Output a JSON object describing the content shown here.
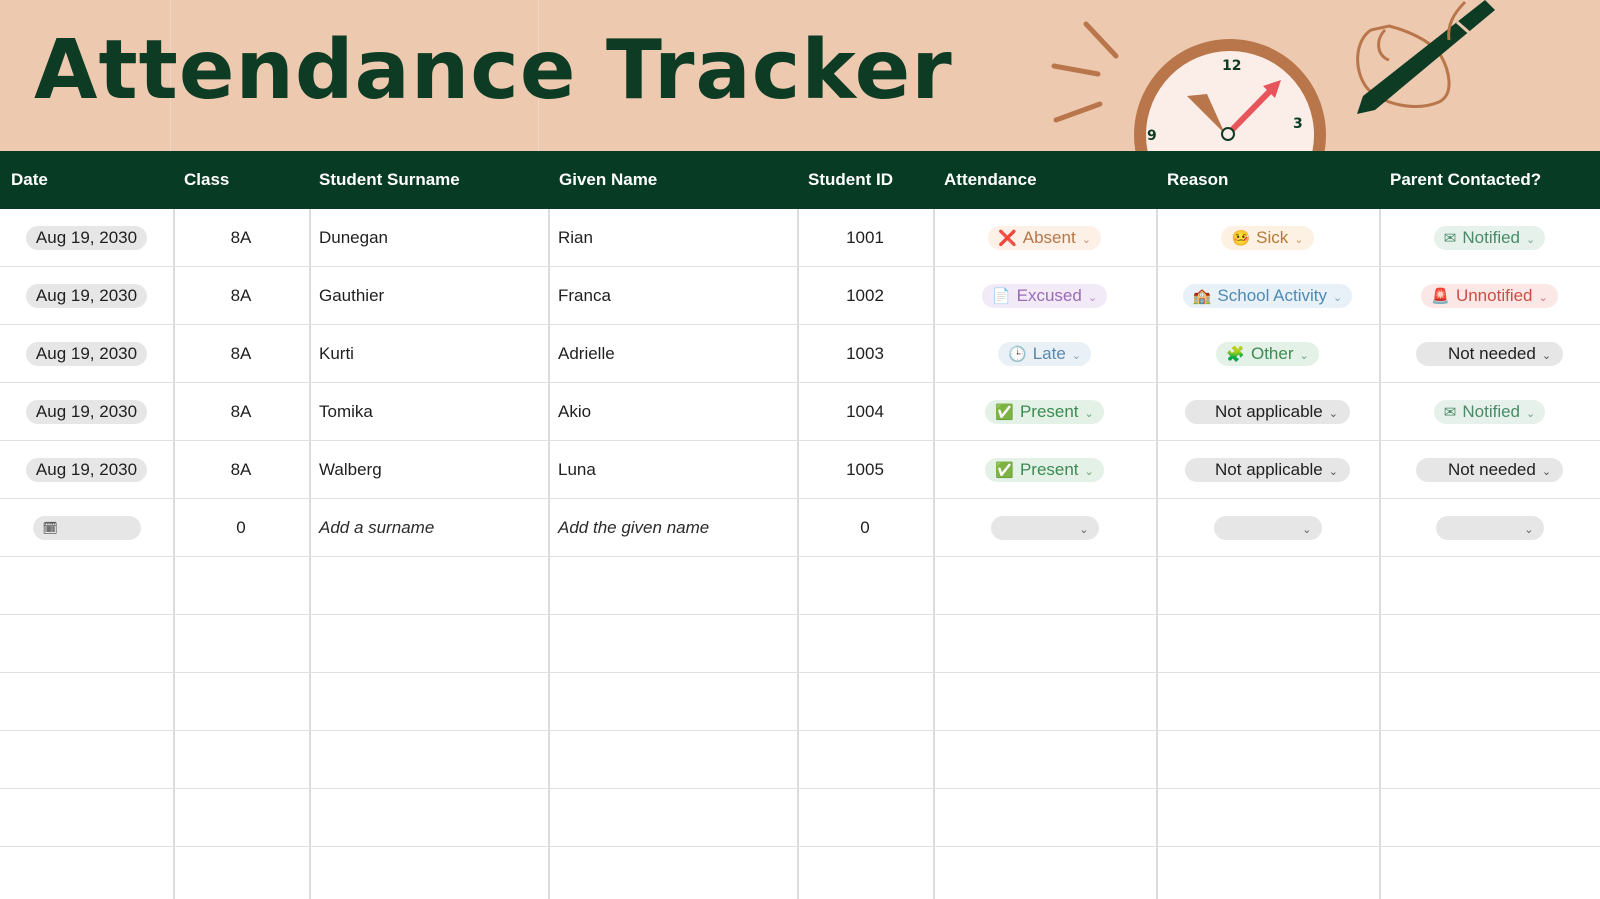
{
  "title": "Attendance Tracker",
  "columns": [
    "Date",
    "Class",
    "Student Surname",
    "Given Name",
    "Student ID",
    "Attendance",
    "Reason",
    "Parent Contacted?"
  ],
  "rows": [
    {
      "date": "Aug 19, 2030",
      "class": "8A",
      "surname": "Dunegan",
      "given": "Rian",
      "id": "1001",
      "attendance": {
        "label": "Absent",
        "icon": "cross-mark-icon",
        "glyph": "❌"
      },
      "reason": {
        "label": "Sick",
        "icon": "sick-face-icon",
        "glyph": "🤒"
      },
      "parent": {
        "label": "Notified",
        "icon": "envelope-icon",
        "glyph": "✉"
      }
    },
    {
      "date": "Aug 19, 2030",
      "class": "8A",
      "surname": "Gauthier",
      "given": "Franca",
      "id": "1002",
      "attendance": {
        "label": "Excused",
        "icon": "document-icon",
        "glyph": "📄"
      },
      "reason": {
        "label": "School Activity",
        "icon": "school-icon",
        "glyph": "🏫"
      },
      "parent": {
        "label": "Unnotified",
        "icon": "alarm-light-icon",
        "glyph": "🚨"
      }
    },
    {
      "date": "Aug 19, 2030",
      "class": "8A",
      "surname": "Kurti",
      "given": "Adrielle",
      "id": "1003",
      "attendance": {
        "label": "Late",
        "icon": "clock-icon",
        "glyph": "🕒"
      },
      "reason": {
        "label": "Other",
        "icon": "puzzle-icon",
        "glyph": "🧩"
      },
      "parent": {
        "label": "Not needed",
        "icon": "",
        "glyph": ""
      }
    },
    {
      "date": "Aug 19, 2030",
      "class": "8A",
      "surname": "Tomika",
      "given": "Akio",
      "id": "1004",
      "attendance": {
        "label": "Present",
        "icon": "check-mark-icon",
        "glyph": "✅"
      },
      "reason": {
        "label": "Not applicable",
        "icon": "",
        "glyph": ""
      },
      "parent": {
        "label": "Notified",
        "icon": "envelope-icon",
        "glyph": "✉"
      }
    },
    {
      "date": "Aug 19, 2030",
      "class": "8A",
      "surname": "Walberg",
      "given": "Luna",
      "id": "1005",
      "attendance": {
        "label": "Present",
        "icon": "check-mark-icon",
        "glyph": "✅"
      },
      "reason": {
        "label": "Not applicable",
        "icon": "",
        "glyph": ""
      },
      "parent": {
        "label": "Not needed",
        "icon": "",
        "glyph": ""
      }
    }
  ],
  "new_row": {
    "class": "0",
    "surname_placeholder": "Add a surname",
    "given_placeholder": "Add the given name",
    "id": "0",
    "date_icon": "calendar-icon",
    "date_glyph": "🗓"
  },
  "colors": {
    "banner": "#edc9b0",
    "header": "#073b24",
    "title": "#0e3b24",
    "clock_rim": "#b9764a",
    "clock_hands": "#e8545c"
  },
  "decorations": [
    "clock-illustration",
    "hand-with-pen-illustration"
  ],
  "clock_numbers": [
    "12",
    "3",
    "9"
  ]
}
